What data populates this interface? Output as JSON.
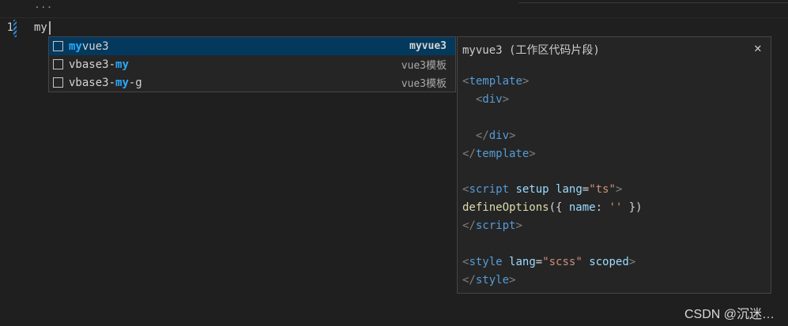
{
  "editor": {
    "breadcrumb": "...",
    "line_number": "1",
    "code_text": "my"
  },
  "suggestions": [
    {
      "match": "my",
      "rest": "vue3",
      "prefix": "",
      "suffix": "",
      "detail": "myvue3",
      "selected": true
    },
    {
      "prefix": "vbase3-",
      "match": "my",
      "suffix": "",
      "detail": "vue3模板",
      "selected": false
    },
    {
      "prefix": "vbase3-",
      "match": "my",
      "suffix": "-g",
      "detail": "vue3模板",
      "selected": false
    }
  ],
  "details": {
    "title": "myvue3 (工作区代码片段)",
    "close_icon": "close-icon",
    "code": {
      "l1_tag": "template",
      "l2_tag": "div",
      "l3_close_div": "div",
      "l4_close_template": "template",
      "l5_tag": "script",
      "l5_attr1": "setup",
      "l5_attr2": "lang",
      "l5_val": "\"ts\"",
      "l6_fn": "defineOptions",
      "l6_open": "({ ",
      "l6_key": "name",
      "l6_colon": ": ",
      "l6_val": "''",
      "l6_close": " })",
      "l7_close_script": "script",
      "l8_tag": "style",
      "l8_attr1": "lang",
      "l8_val": "\"scss\"",
      "l8_attr2": "scoped",
      "l9_close_style": "style"
    }
  },
  "watermark": "CSDN @沉迷…",
  "colors": {
    "background": "#1f1f1f",
    "selected_row": "#04395e",
    "match_highlight": "#2aaaff",
    "tag": "#569cd6",
    "attribute": "#9cdcfe",
    "string": "#ce9178",
    "function": "#dcdcaa"
  }
}
